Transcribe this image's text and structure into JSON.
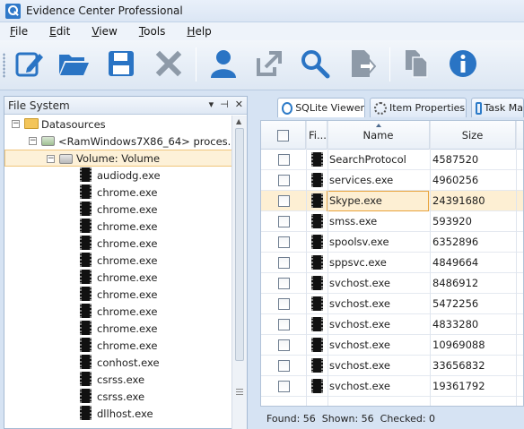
{
  "window": {
    "title": "Evidence Center Professional"
  },
  "menu": [
    {
      "label": "File",
      "accel": "F",
      "rest": "ile"
    },
    {
      "label": "Edit",
      "accel": "E",
      "rest": "dit"
    },
    {
      "label": "View",
      "accel": "V",
      "rest": "iew"
    },
    {
      "label": "Tools",
      "accel": "T",
      "rest": "ools"
    },
    {
      "label": "Help",
      "accel": "H",
      "rest": "elp"
    }
  ],
  "toolbar": {
    "buttons": [
      {
        "icon": "edit-icon"
      },
      {
        "icon": "open-folder-icon"
      },
      {
        "icon": "save-icon"
      },
      {
        "icon": "delete-icon"
      },
      {
        "icon": "user-icon"
      },
      {
        "icon": "export-icon"
      },
      {
        "icon": "search-icon"
      },
      {
        "icon": "export-page-icon"
      },
      {
        "icon": "copy-icon"
      },
      {
        "icon": "info-icon"
      }
    ]
  },
  "left_panel": {
    "title": "File System",
    "controls": [
      "▾",
      "⊣",
      "✕"
    ],
    "tree": [
      {
        "level": 0,
        "expander": "⊟",
        "icon": "folder",
        "label": "Datasources"
      },
      {
        "level": 1,
        "expander": "⊟",
        "icon": "ram",
        "label": "<RamWindows7X86_64> proces..."
      },
      {
        "level": 2,
        "expander": "⊟",
        "icon": "drive",
        "label": "Volume: Volume",
        "selected": true
      },
      {
        "level": 3,
        "icon": "exe",
        "label": "audiodg.exe"
      },
      {
        "level": 3,
        "icon": "exe",
        "label": "chrome.exe"
      },
      {
        "level": 3,
        "icon": "exe",
        "label": "chrome.exe"
      },
      {
        "level": 3,
        "icon": "exe",
        "label": "chrome.exe"
      },
      {
        "level": 3,
        "icon": "exe",
        "label": "chrome.exe"
      },
      {
        "level": 3,
        "icon": "exe",
        "label": "chrome.exe"
      },
      {
        "level": 3,
        "icon": "exe",
        "label": "chrome.exe"
      },
      {
        "level": 3,
        "icon": "exe",
        "label": "chrome.exe"
      },
      {
        "level": 3,
        "icon": "exe",
        "label": "chrome.exe"
      },
      {
        "level": 3,
        "icon": "exe",
        "label": "chrome.exe"
      },
      {
        "level": 3,
        "icon": "exe",
        "label": "chrome.exe"
      },
      {
        "level": 3,
        "icon": "exe",
        "label": "conhost.exe"
      },
      {
        "level": 3,
        "icon": "exe",
        "label": "csrss.exe"
      },
      {
        "level": 3,
        "icon": "exe",
        "label": "csrss.exe"
      },
      {
        "level": 3,
        "icon": "exe",
        "label": "dllhost.exe"
      }
    ]
  },
  "tabs": [
    {
      "label": "SQLite Viewer",
      "active": true
    },
    {
      "label": "Item Properties"
    },
    {
      "label": "Task Ma"
    }
  ],
  "grid": {
    "columns": {
      "check": "",
      "file_icon": "Fi...",
      "name": "Name",
      "size": "Size"
    },
    "rows": [
      {
        "name": "SearchProtocol",
        "size": "4587520"
      },
      {
        "name": "services.exe",
        "size": "4960256"
      },
      {
        "name": "Skype.exe",
        "size": "24391680",
        "selected": true
      },
      {
        "name": "smss.exe",
        "size": "593920"
      },
      {
        "name": "spoolsv.exe",
        "size": "6352896"
      },
      {
        "name": "sppsvc.exe",
        "size": "4849664"
      },
      {
        "name": "svchost.exe",
        "size": "8486912"
      },
      {
        "name": "svchost.exe",
        "size": "5472256"
      },
      {
        "name": "svchost.exe",
        "size": "4833280"
      },
      {
        "name": "svchost.exe",
        "size": "10969088"
      },
      {
        "name": "svchost.exe",
        "size": "33656832"
      },
      {
        "name": "svchost.exe",
        "size": "19361792"
      }
    ]
  },
  "status": {
    "found": "Found: 56",
    "shown": "Shown: 56",
    "checked": "Checked: 0"
  },
  "colors": {
    "accent_blue": "#2f79c9",
    "selection_bg": "#fdefd3",
    "selection_border": "#e8a33c"
  }
}
